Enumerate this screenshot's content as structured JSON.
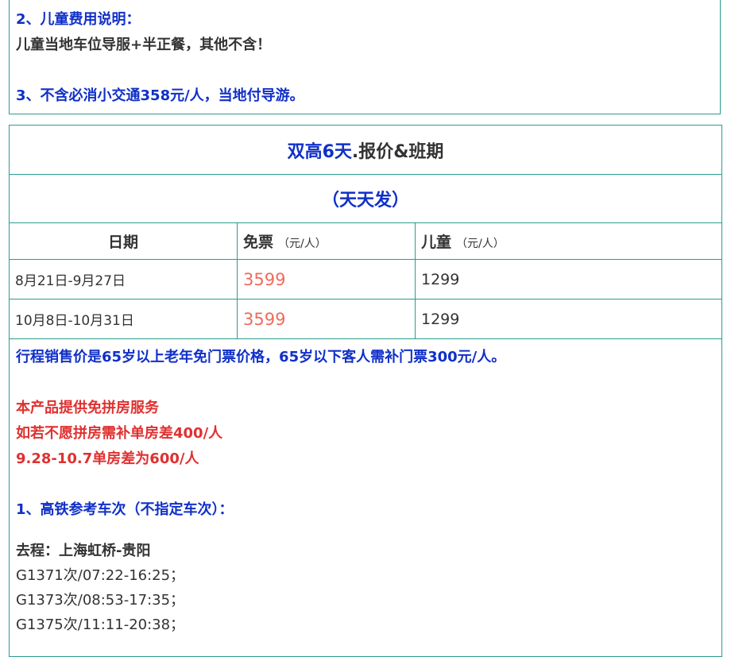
{
  "section_top": {
    "line1": "2、儿童费用说明：",
    "line2": "儿童当地车位导服+半正餐，其他不含！",
    "line3": "3、不含必消小交通358元/人，当地付导游。"
  },
  "table": {
    "title_part1": "双高6天",
    "title_part2": ".报价&班期",
    "subtitle": "（天天发）",
    "headers": {
      "date": "日期",
      "free_ticket": "免票",
      "free_ticket_unit": "（元/人）",
      "child": "儿童",
      "child_unit": "（元/人）"
    },
    "rows": [
      {
        "date": "8月21日-9月27日",
        "price": "3599",
        "child": "1299"
      },
      {
        "date": "10月8日-10月31日",
        "price": "3599",
        "child": "1299"
      }
    ]
  },
  "notes": {
    "price_note": "行程销售价是65岁以上老年免门票价格，65岁以下客人需补门票300元/人。",
    "room_line1": "本产品提供免拼房服务",
    "room_line2": "如若不愿拼房需补单房差400/人",
    "room_line3": "9.28-10.7单房差为600/人",
    "train_title": "1、高铁参考车次（不指定车次）：",
    "outbound_title": "去程：上海虹桥-贵阳",
    "trains": [
      "G1371次/07:22-16:25；",
      "G1373次/08:53-17:35；",
      "G1375次/11:11-20:38；"
    ]
  },
  "colors": {
    "blue": "#1030c8",
    "red": "#e03030",
    "price": "#f06a5a",
    "border": "#2a9d8f"
  }
}
